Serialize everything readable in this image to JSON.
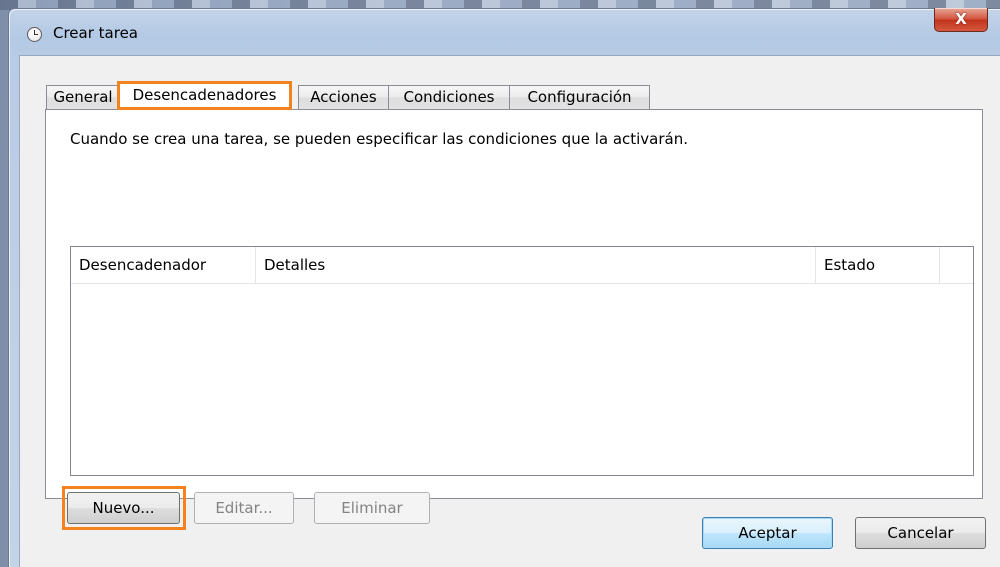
{
  "window": {
    "title": "Crear tarea",
    "close_label": "X"
  },
  "tabs": [
    {
      "label": "General",
      "selected": false
    },
    {
      "label": "Desencadenadores",
      "selected": true
    },
    {
      "label": "Acciones",
      "selected": false
    },
    {
      "label": "Condiciones",
      "selected": false
    },
    {
      "label": "Configuración",
      "selected": false
    }
  ],
  "panel": {
    "description": "Cuando se crea una tarea, se pueden especificar las condiciones que la activarán.",
    "table": {
      "columns": [
        "Desencadenador",
        "Detalles",
        "Estado"
      ],
      "rows": []
    },
    "buttons": {
      "new": "Nuevo...",
      "edit": "Editar...",
      "delete": "Eliminar"
    }
  },
  "footer": {
    "ok": "Aceptar",
    "cancel": "Cancelar"
  },
  "colors": {
    "highlight": "#f3821f",
    "close_button": "#c2341d"
  },
  "icons": {
    "title": "clock-icon",
    "close": "close-icon"
  }
}
